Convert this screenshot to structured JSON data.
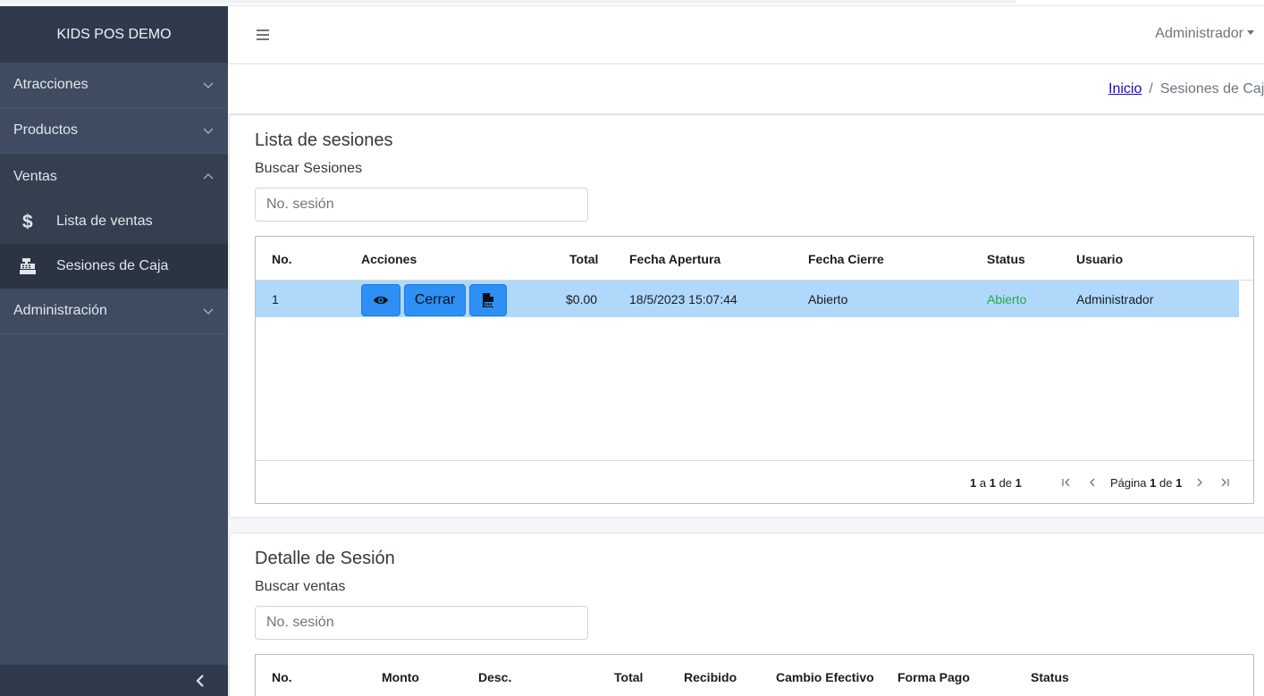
{
  "app": {
    "brand": "KIDS POS DEMO"
  },
  "sidebar": {
    "items": [
      {
        "label": "Atracciones"
      },
      {
        "label": "Productos"
      },
      {
        "label": "Ventas",
        "children": [
          {
            "label": "Lista de ventas",
            "icon": "dollar-icon"
          },
          {
            "label": "Sesiones de Caja",
            "icon": "cash-register-icon"
          }
        ]
      },
      {
        "label": "Administración"
      }
    ]
  },
  "header": {
    "user": "Administrador"
  },
  "breadcrumb": {
    "home": "Inicio",
    "separator": "/",
    "current": "Sesiones de Caja"
  },
  "sessions": {
    "title": "Lista de sesiones",
    "search_label": "Buscar Sesiones",
    "search_placeholder": "No. sesión",
    "columns": [
      "No.",
      "Acciones",
      "Total",
      "Fecha Apertura",
      "Fecha Cierre",
      "Status",
      "Usuario"
    ],
    "rows": [
      {
        "no": "1",
        "total": "$0.00",
        "fecha_apertura": "18/5/2023 15:07:44",
        "fecha_cierre": "Abierto",
        "status": "Abierto",
        "usuario": "Administrador"
      }
    ],
    "actions": {
      "close_label": "Cerrar"
    },
    "footer": {
      "from": "1",
      "a": "a",
      "to": "1",
      "de": "de",
      "total": "1",
      "page_label": "Página",
      "page": "1",
      "pages": "1"
    }
  },
  "detail": {
    "title": "Detalle de Sesión",
    "search_label": "Buscar ventas",
    "search_placeholder": "No. sesión",
    "columns": [
      "No.",
      "Monto",
      "Desc.",
      "Total",
      "Recibido",
      "Cambio Efectivo",
      "Forma Pago",
      "Status"
    ]
  },
  "colors": {
    "sidebar": "#3e4b61",
    "brand_bg": "#2f3a4c",
    "accent": "#2e8ff5",
    "row_selected": "#b0d8fb",
    "status_green": "#28a745"
  }
}
